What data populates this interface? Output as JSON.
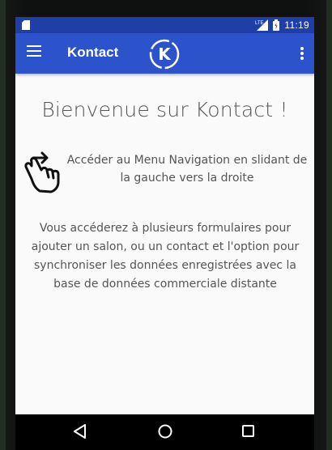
{
  "status_bar": {
    "time": "11:19",
    "network": "LTE",
    "icons": [
      "sd-card-icon",
      "signal-icon",
      "battery-icon"
    ]
  },
  "toolbar": {
    "title": "Kontact",
    "logo_letter": "K",
    "menu_icon": "hamburger-menu-icon",
    "overflow_icon": "more-vertical-icon",
    "color": "#2c52cc"
  },
  "main": {
    "welcome": "Bienvenue sur Kontact !",
    "swipe_hint": "Accéder au Menu Navigation en slidant de la gauche vers la droite",
    "description": "Vous accéderez à plusieurs formulaires pour ajouter un salon, ou un contact et l'option pour synchroniser les données enregistrées avec la base de données commerciale distante",
    "hand_icon": "swipe-hand-icon"
  },
  "nav_bar": {
    "icons": [
      "back-icon",
      "home-icon",
      "recents-icon"
    ]
  },
  "colors": {
    "status_bar": "#1e3fa8",
    "toolbar": "#2c52cc",
    "background": "#fafafa",
    "text": "#555555"
  }
}
